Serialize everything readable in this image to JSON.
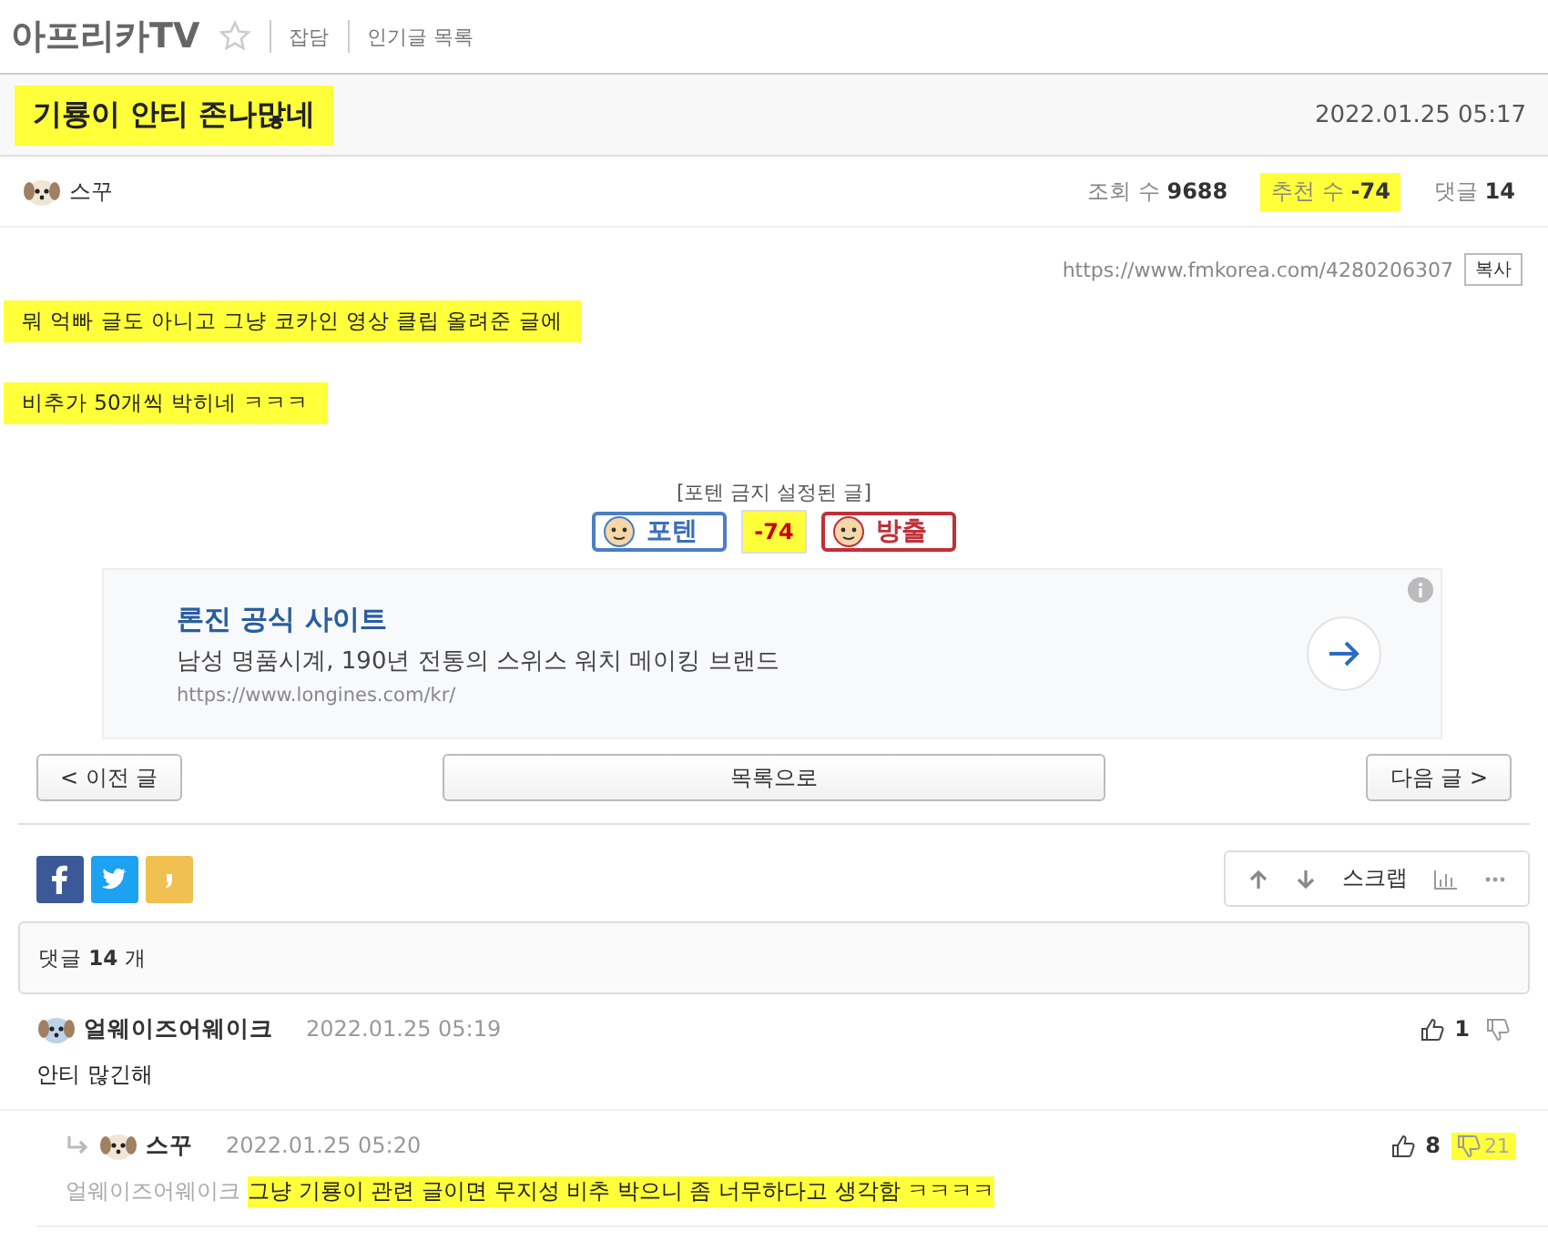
{
  "header": {
    "board": "아프리카TV",
    "links": [
      {
        "label": "잡담"
      },
      {
        "label": "인기글 목록"
      }
    ]
  },
  "post": {
    "title": "기룡이 안티 존나많네",
    "title_highlighted": true,
    "date": "2022.01.25 05:17",
    "author": "스꾸",
    "stats": [
      {
        "label": "조회 수",
        "value": "9688",
        "highlighted": false
      },
      {
        "label": "추천 수",
        "value": "-74",
        "highlighted": true
      },
      {
        "label": "댓글",
        "value": "14",
        "highlighted": false
      }
    ],
    "url": "https://www.fmkorea.com/4280206307",
    "copy_button": "복사",
    "body": [
      {
        "text": "뭐 억빠 글도 아니고 그냥 코카인 영상 클립 올려준 글에",
        "highlighted": true
      },
      {
        "text": "비추가 50개씩 박히네 ㅋㅋㅋ",
        "highlighted": true
      }
    ]
  },
  "vote": {
    "notice": "[포텐 금지 설정된 글]",
    "up_label": "포텐",
    "score": "-74",
    "score_highlighted": true,
    "down_label": "방출"
  },
  "ad": {
    "title": "론진 공식 사이트",
    "description": "남성 명품시계, 190년 전통의 스위스 워치 메이킹 브랜드",
    "url": "https://www.longines.com/kr/"
  },
  "nav": {
    "prev": "< 이전 글",
    "list": "목록으로",
    "next": "다음 글 >"
  },
  "tools": {
    "scrap": "스크랩"
  },
  "comment_count": {
    "label": "댓글",
    "count": "14",
    "unit": "개"
  },
  "comments": [
    {
      "kind": "comment",
      "author": "얼웨이즈어웨이크",
      "date": "2022.01.25 05:19",
      "text": "안티 많긴해",
      "text_highlighted": false,
      "likes": "1",
      "dislikes_highlighted": false
    },
    {
      "kind": "reply",
      "author": "스꾸",
      "date": "2022.01.25 05:20",
      "reply_to": "얼웨이즈어웨이크",
      "text": "그냥 기룡이 관련 글이면 무지성 비추 박으니 좀 너무하다고 생각함 ㅋㅋㅋㅋ",
      "text_highlighted": true,
      "likes": "8",
      "dislikes": "21",
      "dislikes_highlighted": true
    }
  ]
}
